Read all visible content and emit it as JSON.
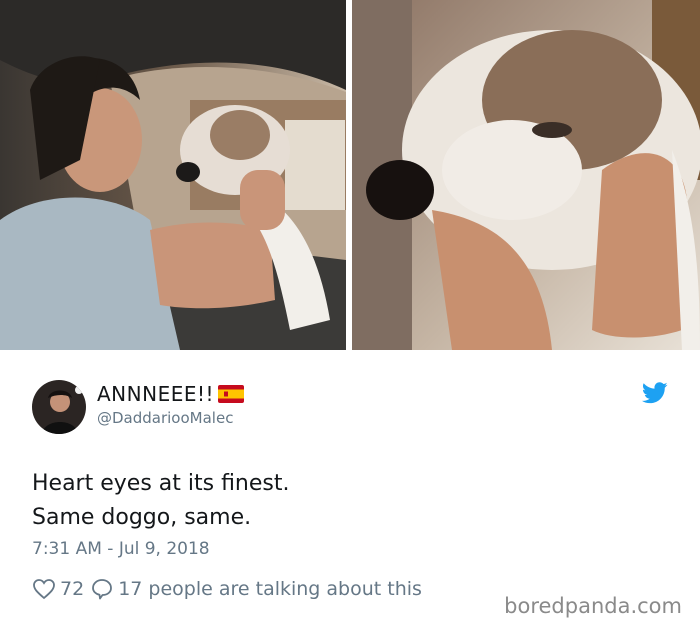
{
  "photos": [
    {
      "description_name": "man-with-dog-in-car-photo"
    },
    {
      "description_name": "dog-closeup-photo"
    }
  ],
  "tweet": {
    "display_name": "ANNNEEE!!",
    "handle": "@DaddariooMalec",
    "text_lines": [
      "Heart eyes at its finest.",
      "Same doggo, same."
    ],
    "timestamp": "7:31 AM - Jul 9, 2018",
    "likes": "72",
    "replies_text": "17 people are talking about this"
  },
  "watermark": "boredpanda.com",
  "colors": {
    "text": "#14171a",
    "muted": "#657786",
    "twitter_blue": "#1da1f2",
    "watermark": "#8a8a8a"
  },
  "icons": [
    "twitter-bird-icon",
    "heart-icon",
    "reply-bubble-icon",
    "spain-flag-icon"
  ]
}
